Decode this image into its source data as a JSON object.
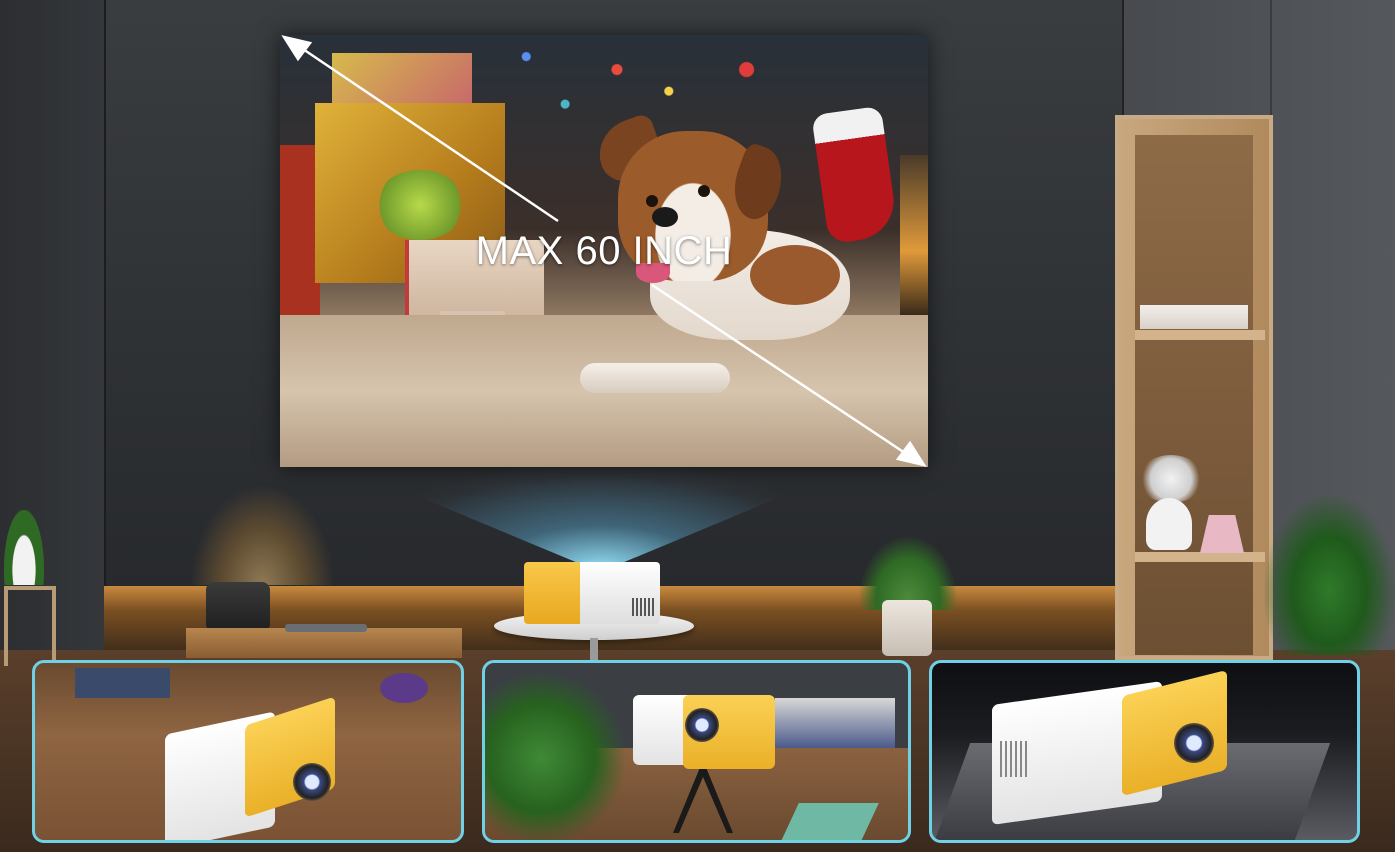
{
  "screen": {
    "caption": "MAX 60 INCH"
  },
  "colors": {
    "thumbnail_border": "#6fd0e6",
    "projector_yellow": "#f9c84a",
    "projector_white": "#ffffff",
    "wall": "#2e3134",
    "beam": "#96e6ff"
  },
  "icons": [
    "diagonal-double-arrow"
  ]
}
